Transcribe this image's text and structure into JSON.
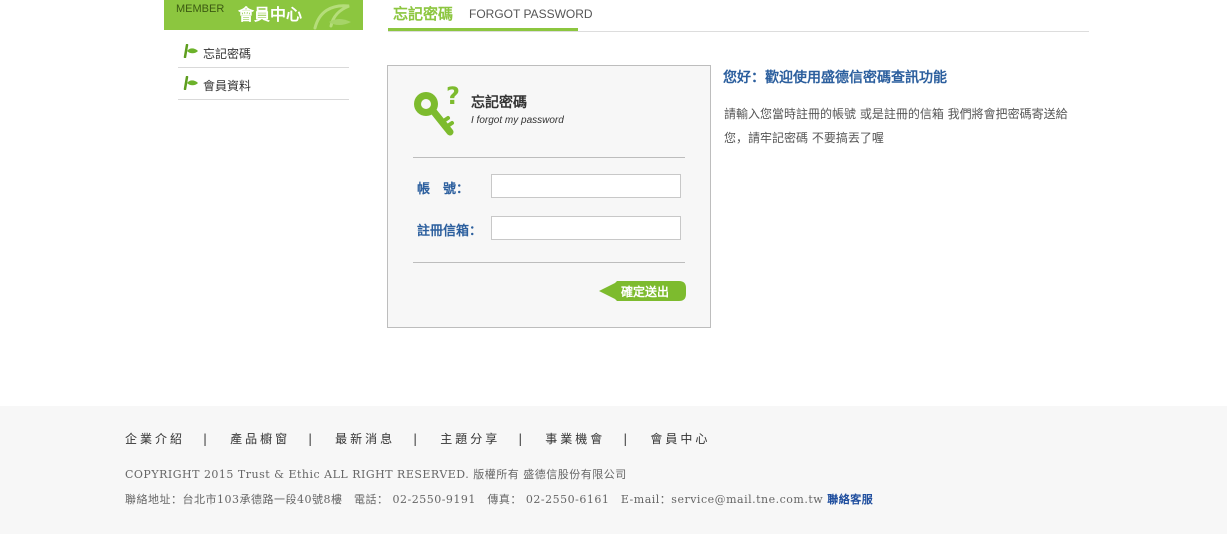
{
  "sidebar": {
    "header_en": "MEMBER",
    "header_zh": "會員中心",
    "items": [
      {
        "label": "忘記密碼"
      },
      {
        "label": "會員資料"
      }
    ]
  },
  "page_title": {
    "zh": "忘記密碼",
    "en": "FORGOT PASSWORD"
  },
  "form": {
    "title": "忘記密碼",
    "subtitle": "I forgot my password",
    "account_label": "帳　號：",
    "account_value": "",
    "email_label": "註冊信箱：",
    "email_value": "",
    "submit_label": "確定送出"
  },
  "intro": {
    "title": "您好：歡迎使用盛德信密碼查訊功能",
    "text": "請輸入您當時註冊的帳號 或是註冊的信箱 我們將會把密碼寄送給您，請牢記密碼 不要搞丟了喔"
  },
  "footer": {
    "nav": [
      "企業介紹",
      "產品櫥窗",
      "最新消息",
      "主題分享",
      "事業機會",
      "會員中心"
    ],
    "separator": "|",
    "copyright": "COPYRIGHT 2015 Trust & Ethic ALL RIGHT RESERVED.  版權所有 盛德信股份有限公司",
    "contact": "聯絡地址：台北市103承德路一段40號8樓　電話： 02-2550-9191　傳真： 02-2550-6161　E-mail：service@mail.tne.com.tw ",
    "contact_link": "聯絡客服"
  },
  "colors": {
    "accent_green": "#8cc63f",
    "label_blue": "#2c5f9e",
    "link_blue": "#1f4e9e"
  },
  "icons": {
    "sidebar_bullet": "leaf-arrow-icon",
    "form_icon": "key-question-icon",
    "header_decor": "leaf-swirl-icon"
  }
}
